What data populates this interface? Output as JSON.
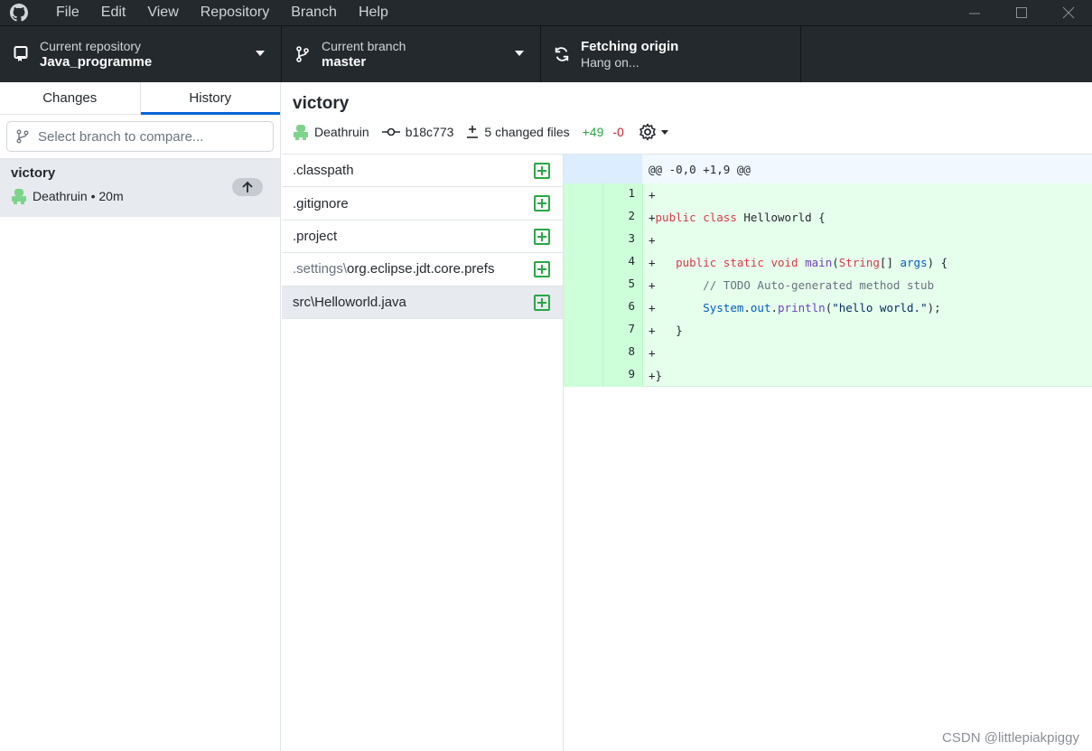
{
  "menu": [
    "File",
    "Edit",
    "View",
    "Repository",
    "Branch",
    "Help"
  ],
  "toolbar": {
    "repo_label": "Current repository",
    "repo_value": "Java_programme",
    "branch_label": "Current branch",
    "branch_value": "master",
    "fetch_title": "Fetching origin",
    "fetch_status": "Hang on..."
  },
  "sidebar": {
    "tabs": [
      {
        "label": "Changes"
      },
      {
        "label": "History"
      }
    ],
    "selected_tab": "History",
    "compare_placeholder": "Select branch to compare...",
    "commits": [
      {
        "title": "victory",
        "author_time": "Deathruin • 20m"
      }
    ]
  },
  "commit": {
    "title": "victory",
    "author": "Deathruin",
    "sha": "b18c773",
    "changed_files": "5 changed files",
    "additions": "+49",
    "deletions": "-0"
  },
  "files": [
    {
      "dir": "",
      "name": ".classpath"
    },
    {
      "dir": "",
      "name": ".gitignore"
    },
    {
      "dir": "",
      "name": ".project"
    },
    {
      "dir": ".settings\\",
      "name": "org.eclipse.jdt.core.prefs"
    },
    {
      "dir": "",
      "name": "src\\Helloworld.java"
    }
  ],
  "diff": {
    "hunk_header": "@@ -0,0 +1,9 @@",
    "line_numbers": [
      "1",
      "2",
      "3",
      "4",
      "5",
      "6",
      "7",
      "8",
      "9"
    ]
  },
  "watermark": "CSDN @littlepiakpiggy",
  "colors": {
    "titlebar_bg": "#24292e",
    "accent_blue": "#0366d6",
    "added_green": "#28a745",
    "deleted_red": "#cb2431",
    "diff_added_bg": "#e6ffed"
  }
}
